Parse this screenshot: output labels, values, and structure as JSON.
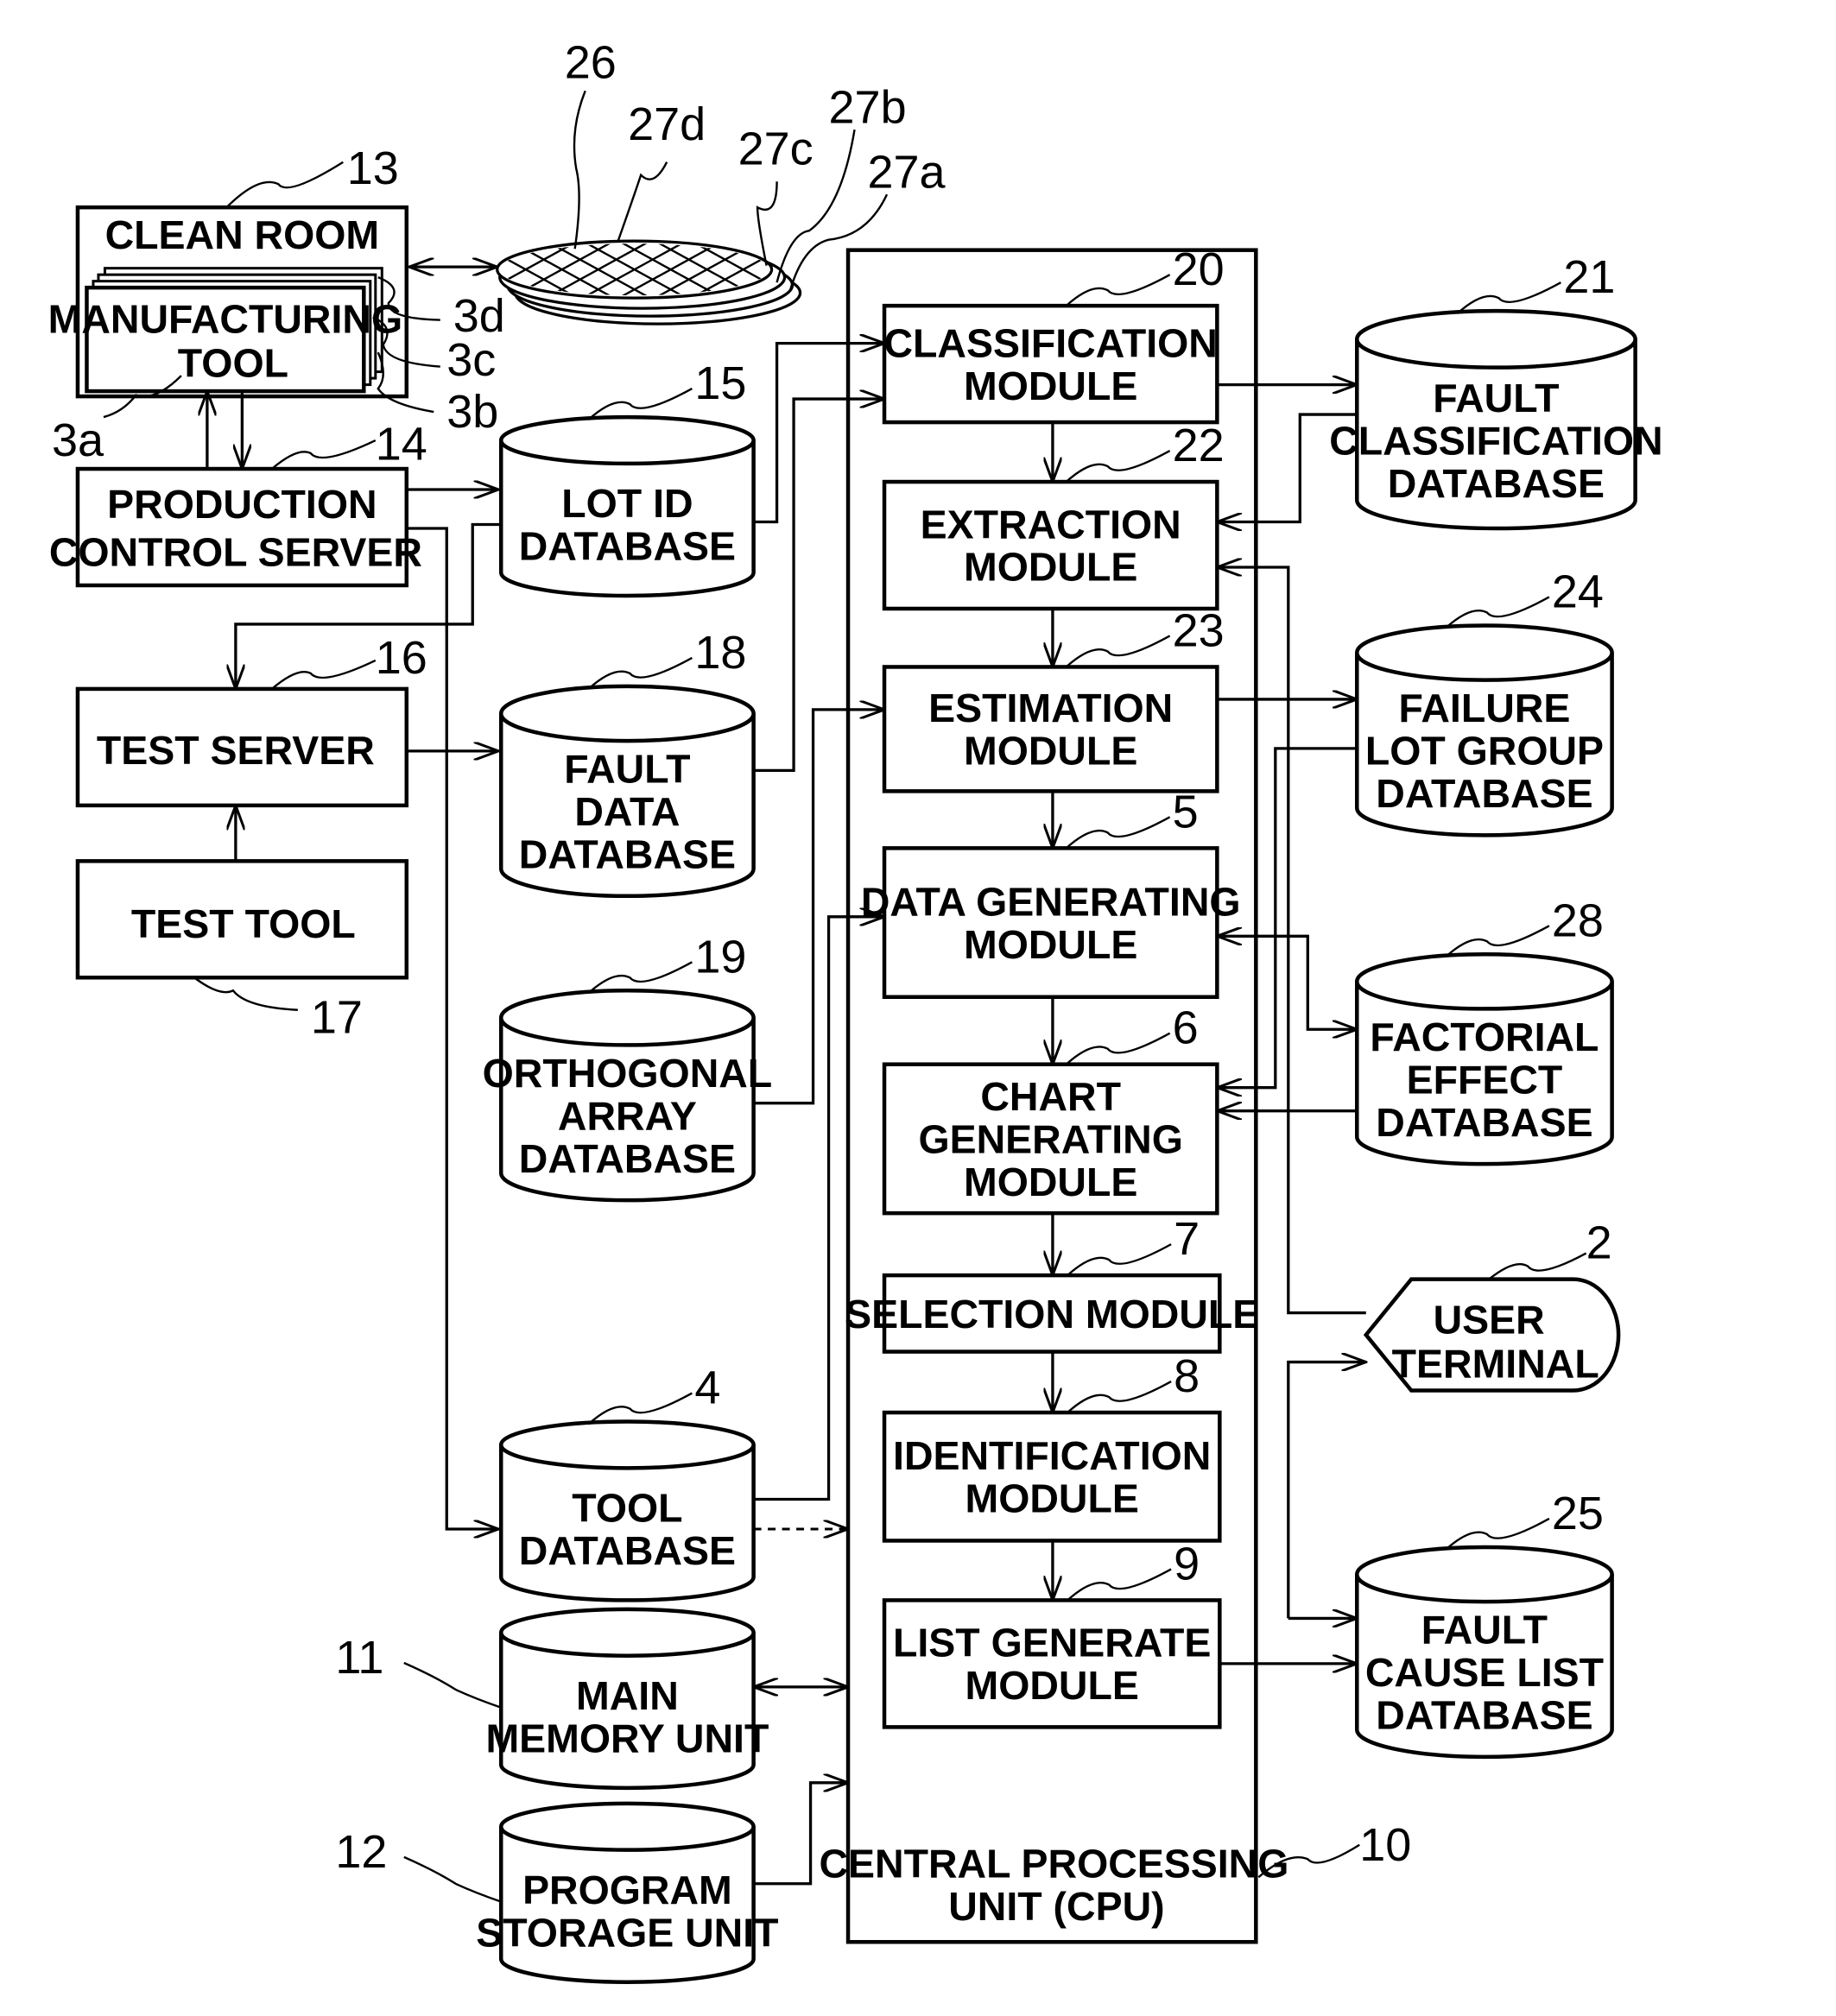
{
  "figure": {
    "description": "Block diagram of a fault-cause analysis system with manufacturing, test, databases and CPU modules",
    "colors": {
      "ink": "#000000",
      "paper": "#ffffff"
    }
  },
  "clean_room": {
    "ref": "13",
    "label": "CLEAN ROOM"
  },
  "manufacturing_tool": {
    "lines": [
      "MANUFACTURING",
      "TOOL"
    ],
    "refs": [
      "3a",
      "3b",
      "3c",
      "3d"
    ]
  },
  "wafer": {
    "ref": "26",
    "lot_refs": [
      "27a",
      "27b",
      "27c",
      "27d"
    ]
  },
  "production_control_server": {
    "ref": "14",
    "lines": [
      "PRODUCTION",
      "CONTROL SERVER"
    ]
  },
  "test_server": {
    "ref": "16",
    "lines": [
      "TEST SERVER"
    ]
  },
  "test_tool": {
    "ref": "17",
    "lines": [
      "TEST TOOL"
    ]
  },
  "left_databases": [
    {
      "id": "lot-id-db",
      "ref": "15",
      "lines": [
        "LOT ID",
        "DATABASE"
      ]
    },
    {
      "id": "fault-data-db",
      "ref": "18",
      "lines": [
        "FAULT",
        "DATA",
        "DATABASE"
      ]
    },
    {
      "id": "orthogonal-array-db",
      "ref": "19",
      "lines": [
        "ORTHOGONAL",
        "ARRAY",
        "DATABASE"
      ]
    },
    {
      "id": "tool-db",
      "ref": "4",
      "lines": [
        "TOOL",
        "DATABASE"
      ]
    },
    {
      "id": "main-memory-unit",
      "ref": "11",
      "lines": [
        "MAIN",
        "MEMORY UNIT"
      ]
    },
    {
      "id": "program-storage-unit",
      "ref": "12",
      "lines": [
        "PROGRAM",
        "STORAGE UNIT"
      ]
    }
  ],
  "cpu": {
    "ref": "10",
    "lines": [
      "CENTRAL PROCESSING",
      "UNIT (CPU)"
    ],
    "modules": [
      {
        "id": "classification-module",
        "ref": "20",
        "lines": [
          "CLASSIFICATION",
          "MODULE"
        ]
      },
      {
        "id": "extraction-module",
        "ref": "22",
        "lines": [
          "EXTRACTION",
          "MODULE"
        ]
      },
      {
        "id": "estimation-module",
        "ref": "23",
        "lines": [
          "ESTIMATION",
          "MODULE"
        ]
      },
      {
        "id": "data-generating-module",
        "ref": "5",
        "lines": [
          "DATA GENERATING",
          "MODULE"
        ]
      },
      {
        "id": "chart-generating-module",
        "ref": "6",
        "lines": [
          "CHART",
          "GENERATING",
          "MODULE"
        ]
      },
      {
        "id": "selection-module",
        "ref": "7",
        "lines": [
          "SELECTION MODULE"
        ]
      },
      {
        "id": "identification-module",
        "ref": "8",
        "lines": [
          "IDENTIFICATION",
          "MODULE"
        ]
      },
      {
        "id": "list-generate-module",
        "ref": "9",
        "lines": [
          "LIST GENERATE",
          "MODULE"
        ]
      }
    ]
  },
  "right_databases": [
    {
      "id": "fault-classification-db",
      "ref": "21",
      "lines": [
        "FAULT",
        "CLASSIFICATION",
        "DATABASE"
      ]
    },
    {
      "id": "failure-lot-group-db",
      "ref": "24",
      "lines": [
        "FAILURE",
        "LOT GROUP",
        "DATABASE"
      ]
    },
    {
      "id": "factorial-effect-db",
      "ref": "28",
      "lines": [
        "FACTORIAL",
        "EFFECT",
        "DATABASE"
      ]
    },
    {
      "id": "fault-cause-list-db",
      "ref": "25",
      "lines": [
        "FAULT",
        "CAUSE LIST",
        "DATABASE"
      ]
    }
  ],
  "user_terminal": {
    "ref": "2",
    "lines": [
      "USER",
      "TERMINAL"
    ]
  }
}
